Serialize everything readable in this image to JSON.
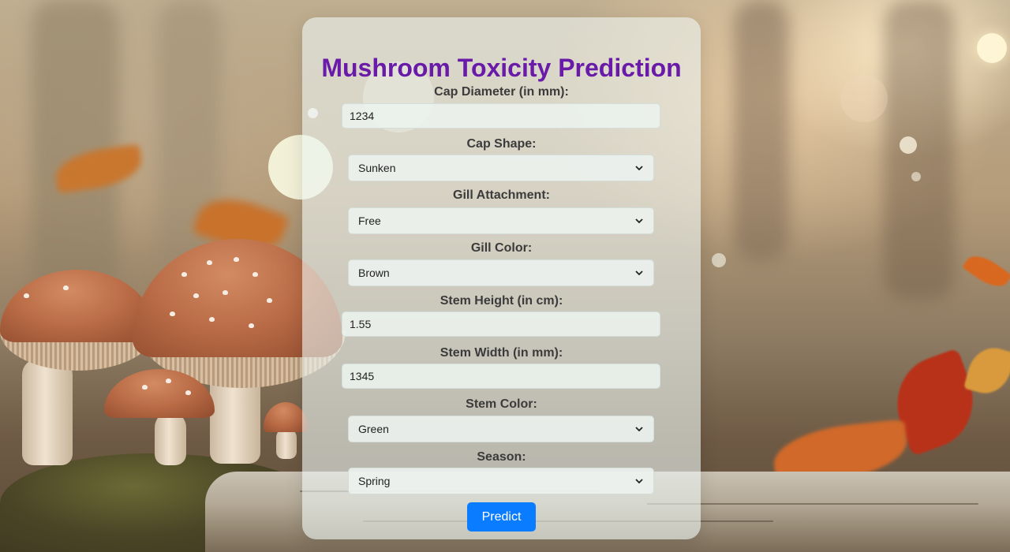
{
  "page": {
    "title": "Mushroom Toxicity Prediction",
    "colors": {
      "title": "#6a1aa8",
      "button": "#0a7cff"
    }
  },
  "form": {
    "cap_diameter": {
      "label": "Cap Diameter (in mm):",
      "value": "1234"
    },
    "cap_shape": {
      "label": "Cap Shape:",
      "selected": "Sunken"
    },
    "gill_attachment": {
      "label": "Gill Attachment:",
      "selected": "Free"
    },
    "gill_color": {
      "label": "Gill Color:",
      "selected": "Brown"
    },
    "stem_height": {
      "label": "Stem Height (in cm):",
      "value": "1.55"
    },
    "stem_width": {
      "label": "Stem Width (in mm):",
      "value": "1345"
    },
    "stem_color": {
      "label": "Stem Color:",
      "selected": "Green"
    },
    "season": {
      "label": "Season:",
      "selected": "Spring"
    },
    "submit_label": "Predict"
  }
}
